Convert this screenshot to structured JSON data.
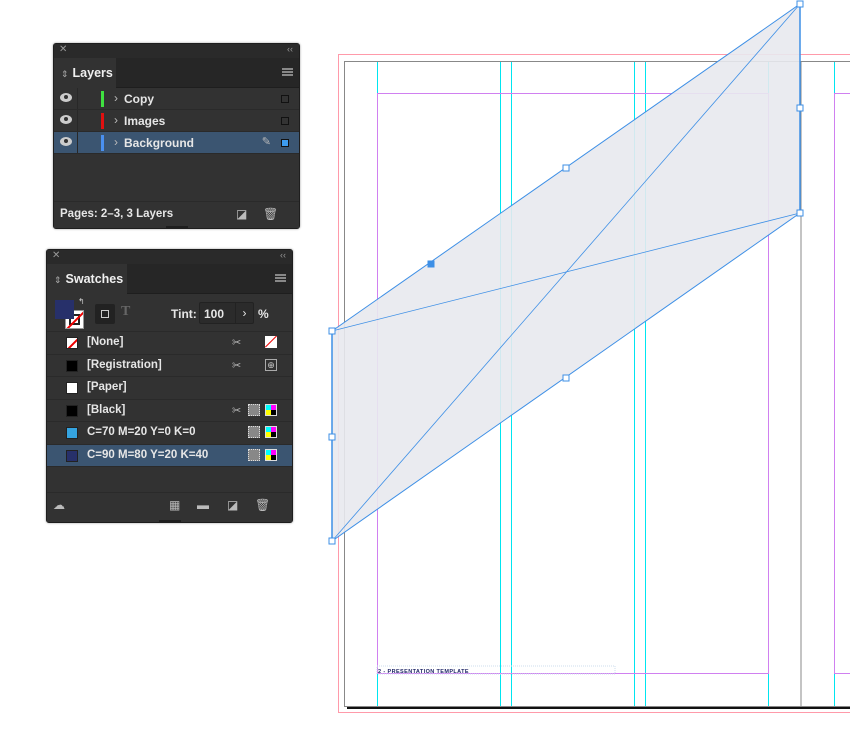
{
  "layers_panel": {
    "title": "Layers",
    "layers": [
      {
        "name": "Copy",
        "color": "#3fe040",
        "selected": false
      },
      {
        "name": "Images",
        "color": "#e01010",
        "selected": false
      },
      {
        "name": "Background",
        "color": "#4a90f0",
        "selected": true
      }
    ],
    "status": "Pages: 2–3, 3 Layers",
    "icons": [
      "close-icon",
      "collapse-icon",
      "panel-menu-icon",
      "visibility-eye-icon",
      "expand-chevron-icon",
      "pencil-icon",
      "new-layer-icon",
      "trash-icon"
    ]
  },
  "swatches_panel": {
    "title": "Swatches",
    "tint_label": "Tint:",
    "tint_value": "100",
    "tint_unit": "%",
    "fill_color": "#27306a",
    "swatches": [
      {
        "name": "[None]",
        "color": "none"
      },
      {
        "name": "[Registration]",
        "color": "#000000"
      },
      {
        "name": "[Paper]",
        "color": "#ffffff"
      },
      {
        "name": "[Black]",
        "color": "#000000"
      },
      {
        "name": "C=70 M=20 Y=0 K=0",
        "color": "#35a4e0"
      },
      {
        "name": "C=90 M=80 Y=20 K=40",
        "color": "#27306a",
        "selected": true
      }
    ]
  },
  "document": {
    "footer_text": "2 - PRESENTATION TEMPLATE",
    "colors": {
      "bleed": "#ff9aaa",
      "margin": "#d080f0",
      "column": "#00e5f0",
      "selection": "#3d8fe6",
      "shape_fill": "#e8e9ee"
    }
  }
}
